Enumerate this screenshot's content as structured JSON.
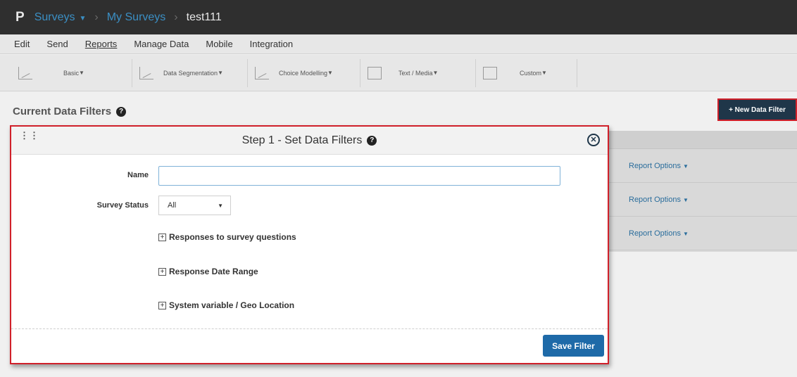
{
  "topbar": {
    "logo": "P",
    "breadcrumb": [
      "Surveys",
      "My Surveys",
      "test111"
    ]
  },
  "menu": [
    "Edit",
    "Send",
    "Reports",
    "Manage Data",
    "Mobile",
    "Integration"
  ],
  "ribbon": [
    {
      "label": "Basic",
      "icon": "line-chart-icon"
    },
    {
      "label": "Data Segmentation",
      "icon": "segmentation-chart-icon"
    },
    {
      "label": "Choice Modelling",
      "icon": "bar-chart-icon"
    },
    {
      "label": "Text / Media",
      "icon": "media-icon"
    },
    {
      "label": "Custom",
      "icon": "custom-report-icon"
    }
  ],
  "page": {
    "title": "Current Data Filters",
    "new_filter_label": "+ New Data Filter",
    "report_options": [
      "Report Options",
      "Report Options",
      "Report Options"
    ]
  },
  "modal": {
    "title": "Step 1 - Set Data Filters",
    "name_label": "Name",
    "name_value": "",
    "status_label": "Survey Status",
    "status_value": "All",
    "sections": [
      "Responses to survey questions",
      "Response Date Range",
      "System variable / Geo Location"
    ],
    "save_label": "Save Filter"
  },
  "colors": {
    "accent": "#1e6aa8",
    "highlight": "#d0202a",
    "header_dark": "#1f3649"
  }
}
